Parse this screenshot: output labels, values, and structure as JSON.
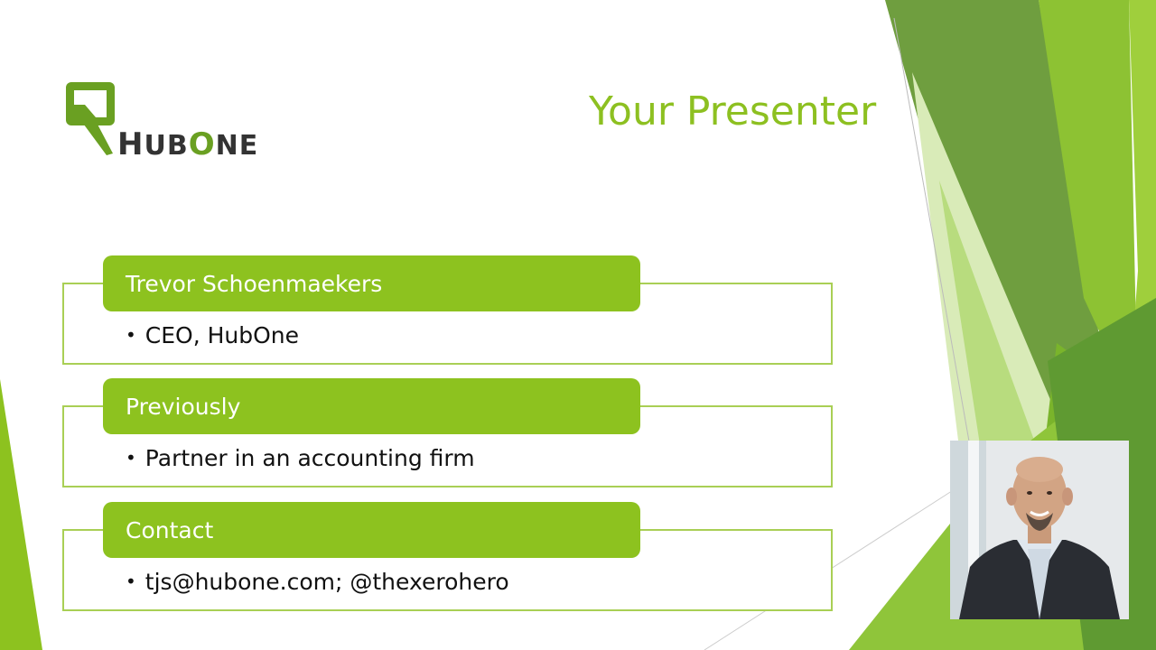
{
  "slide": {
    "title": "Your Presenter"
  },
  "logo": {
    "text_h": "H",
    "text_ub": "UB",
    "text_o": "O",
    "text_ne": "NE",
    "colors": {
      "green": "#6aa022",
      "dark": "#333333"
    }
  },
  "cards": [
    {
      "heading": "Trevor Schoenmaekers",
      "bullet": "CEO, HubOne"
    },
    {
      "heading": "Previously",
      "bullet": "Partner in an accounting firm"
    },
    {
      "heading": "Contact",
      "bullet": "tjs@hubone.com; @thexerohero"
    }
  ],
  "photo": {
    "icon": "presenter-photo"
  },
  "colors": {
    "accent": "#8dc21f",
    "title": "#8dc021",
    "border": "#a9cf55"
  }
}
